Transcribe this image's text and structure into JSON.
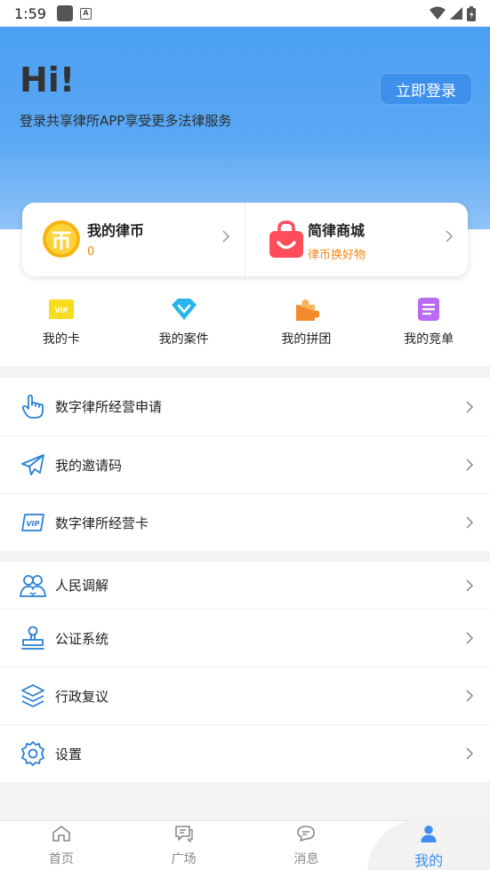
{
  "status": {
    "time": "1:59"
  },
  "header": {
    "greeting": "Hi!",
    "subtitle": "登录共享律所APP享受更多法律服务",
    "login_label": "立即登录"
  },
  "cards": [
    {
      "title": "我的律币",
      "subtitle": "0",
      "icon": "coin-icon"
    },
    {
      "title": "简律商城",
      "subtitle": "律币换好物",
      "icon": "shopping-bag-icon"
    }
  ],
  "quick_actions": [
    {
      "label": "我的卡",
      "icon": "vip-card-icon"
    },
    {
      "label": "我的案件",
      "icon": "diamond-icon"
    },
    {
      "label": "我的拼团",
      "icon": "puzzle-icon"
    },
    {
      "label": "我的竞单",
      "icon": "document-icon"
    }
  ],
  "menu_group1": [
    {
      "label": "数字律所经营申请",
      "icon": "hand-pointer-icon"
    },
    {
      "label": "我的邀请码",
      "icon": "paper-plane-icon"
    },
    {
      "label": "数字律所经营卡",
      "icon": "vip-icon"
    }
  ],
  "menu_group2": [
    {
      "label": "人民调解",
      "icon": "people-icon"
    },
    {
      "label": "公证系统",
      "icon": "stamp-icon"
    },
    {
      "label": "行政复议",
      "icon": "layers-icon"
    },
    {
      "label": "设置",
      "icon": "gear-icon"
    }
  ],
  "tabs": [
    {
      "label": "首页",
      "icon": "home-icon"
    },
    {
      "label": "广场",
      "icon": "chat-square-icon"
    },
    {
      "label": "消息",
      "icon": "message-icon"
    },
    {
      "label": "我的",
      "icon": "user-icon",
      "active": true
    }
  ],
  "colors": {
    "accent": "#3d8ef0",
    "orange": "#f08a1c",
    "icon_blue": "#2a7fd4"
  }
}
